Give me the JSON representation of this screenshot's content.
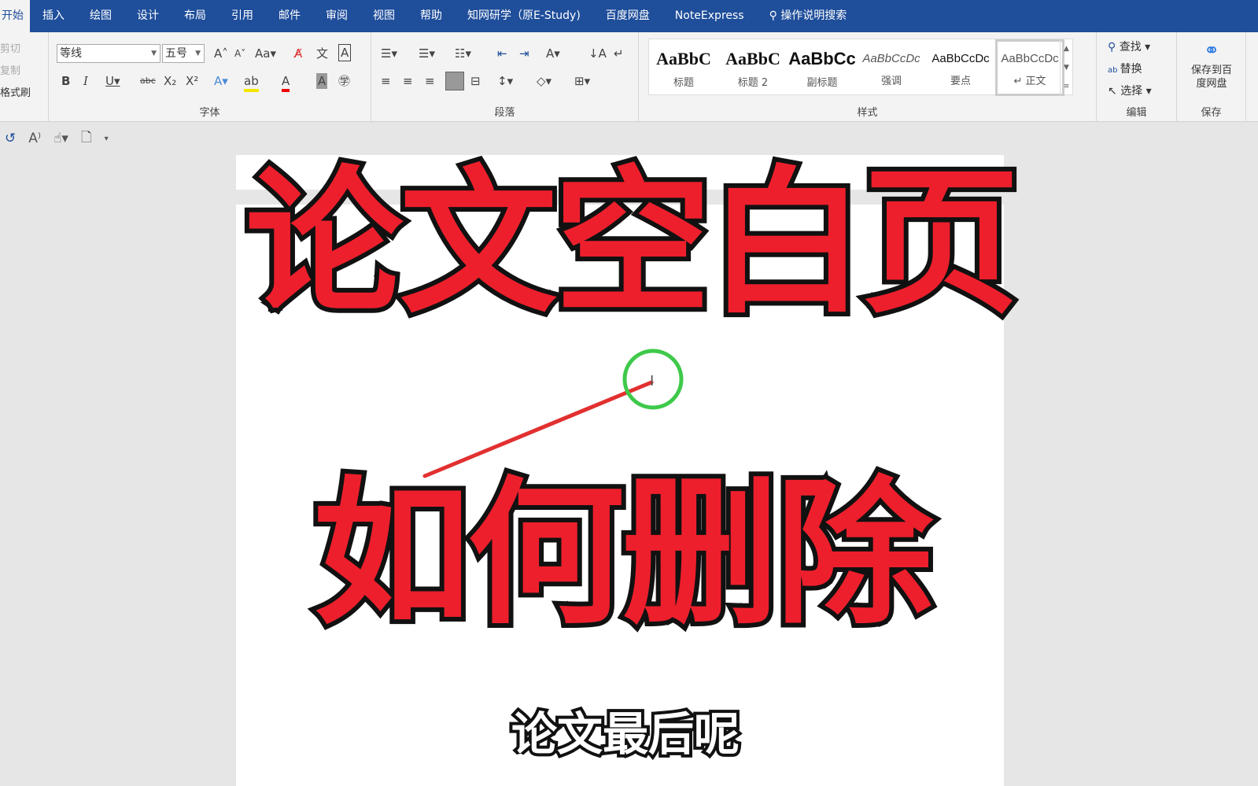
{
  "tabs": [
    "开始",
    "插入",
    "绘图",
    "设计",
    "布局",
    "引用",
    "邮件",
    "审阅",
    "视图",
    "帮助",
    "知网研学（原E-Study)",
    "百度网盘",
    "NoteExpress"
  ],
  "tell_me": "操作说明搜索",
  "clipboard": {
    "cut": "剪切",
    "copy": "复制",
    "format_painter": "格式刷"
  },
  "font": {
    "name": "等线",
    "size": "五号",
    "label": "字体"
  },
  "paragraph": {
    "label": "段落"
  },
  "styles": {
    "label": "样式",
    "items": [
      {
        "preview": "AaBbC",
        "name": "标题"
      },
      {
        "preview": "AaBbC",
        "name": "标题 2"
      },
      {
        "preview": "AaBbCc",
        "name": "副标题"
      },
      {
        "preview": "AaBbCcDc",
        "name": "强调"
      },
      {
        "preview": "AaBbCcDc",
        "name": "要点"
      },
      {
        "preview": "AaBbCcDc",
        "name": "↵ 正文"
      }
    ]
  },
  "editing": {
    "find": "查找",
    "replace": "替换",
    "select": "选择",
    "label": "编辑"
  },
  "save": {
    "button": "保存到百度网盘",
    "label": "保存"
  },
  "overlay": {
    "title1": "论文空白页",
    "title2": "如何删除",
    "caption": "论文最后呢"
  },
  "colors": {
    "tab_bar": "#1f4e9b",
    "overlay_red": "#ee1f2c",
    "highlight_circle": "#3ec94a"
  }
}
